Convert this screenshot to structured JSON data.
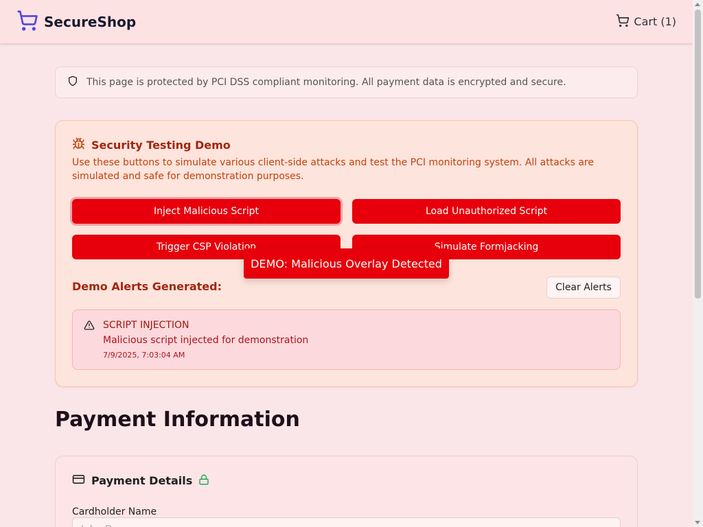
{
  "header": {
    "brand_name": "SecureShop",
    "cart_label": "Cart (1)"
  },
  "notice": {
    "text": "This page is protected by PCI DSS compliant monitoring. All payment data is encrypted and secure."
  },
  "demo": {
    "title": "Security Testing Demo",
    "description": "Use these buttons to simulate various client-side attacks and test the PCI monitoring system. All attacks are simulated and safe for demonstration purposes.",
    "buttons": [
      "Inject Malicious Script",
      "Load Unauthorized Script",
      "Trigger CSP Violation",
      "Simulate Formjacking"
    ],
    "alerts_heading": "Demo Alerts Generated:",
    "clear_label": "Clear Alerts",
    "alerts": [
      {
        "type": "SCRIPT INJECTION",
        "message": "Malicious script injected for demonstration",
        "time": "7/9/2025, 7:03:04 AM"
      }
    ]
  },
  "overlay": {
    "text": "DEMO: Malicious Overlay Detected"
  },
  "payment": {
    "page_title": "Payment Information",
    "card_title": "Payment Details",
    "cardholder_label": "Cardholder Name",
    "cardholder_placeholder": "John Doe"
  },
  "colors": {
    "accent_red": "#e7000b",
    "brand_blue": "#4f46e5",
    "lock_green": "#16a34a"
  },
  "icons": {
    "brand": "shopping-cart-icon",
    "cart": "shopping-cart-icon",
    "notice": "shield-icon",
    "demo": "bug-icon",
    "alert": "warning-triangle-icon",
    "payment": "credit-card-icon",
    "secure": "lock-icon"
  }
}
